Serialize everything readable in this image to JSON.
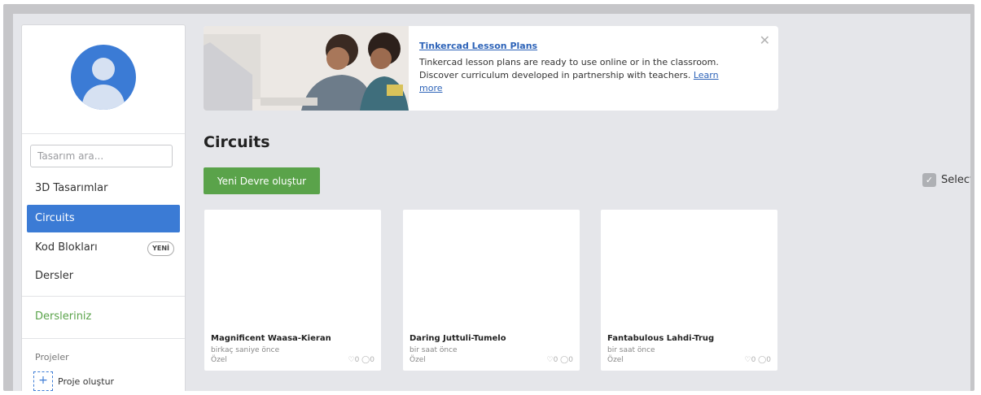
{
  "sidebar": {
    "search_placeholder": "Tasarım ara...",
    "items": [
      {
        "label": "3D Tasarımlar"
      },
      {
        "label": "Circuits"
      },
      {
        "label": "Kod Blokları",
        "badge": "YENİ"
      },
      {
        "label": "Dersler"
      }
    ],
    "lessons_label": "Dersleriniz",
    "projects_title": "Projeler",
    "create_project_label": "Proje oluştur",
    "plus_symbol": "+"
  },
  "banner": {
    "title": "Tinkercad Lesson Plans",
    "text": "Tinkercad lesson plans are ready to use online or in the classroom. Discover curriculum developed in partnership with teachers.",
    "link_label": "Learn more",
    "close_symbol": "✕"
  },
  "main": {
    "title": "Circuits",
    "new_button_label": "Yeni Devre oluştur",
    "select_label": "Select",
    "check_symbol": "✓"
  },
  "cards": [
    {
      "title": "Magnificent Waasa-Kieran",
      "time": "birkaç saniye önce",
      "visibility": "Özel",
      "stats": "♡0 ◯0"
    },
    {
      "title": "Daring Juttuli-Tumelo",
      "time": "bir saat önce",
      "visibility": "Özel",
      "stats": "♡0 ◯0"
    },
    {
      "title": "Fantabulous Lahdi-Trug",
      "time": "bir saat önce",
      "visibility": "Özel",
      "stats": "♡0 ◯0"
    }
  ],
  "colors": {
    "accent_blue": "#3b7bd5",
    "accent_green": "#5aa34a",
    "background": "#e5e6ea"
  }
}
